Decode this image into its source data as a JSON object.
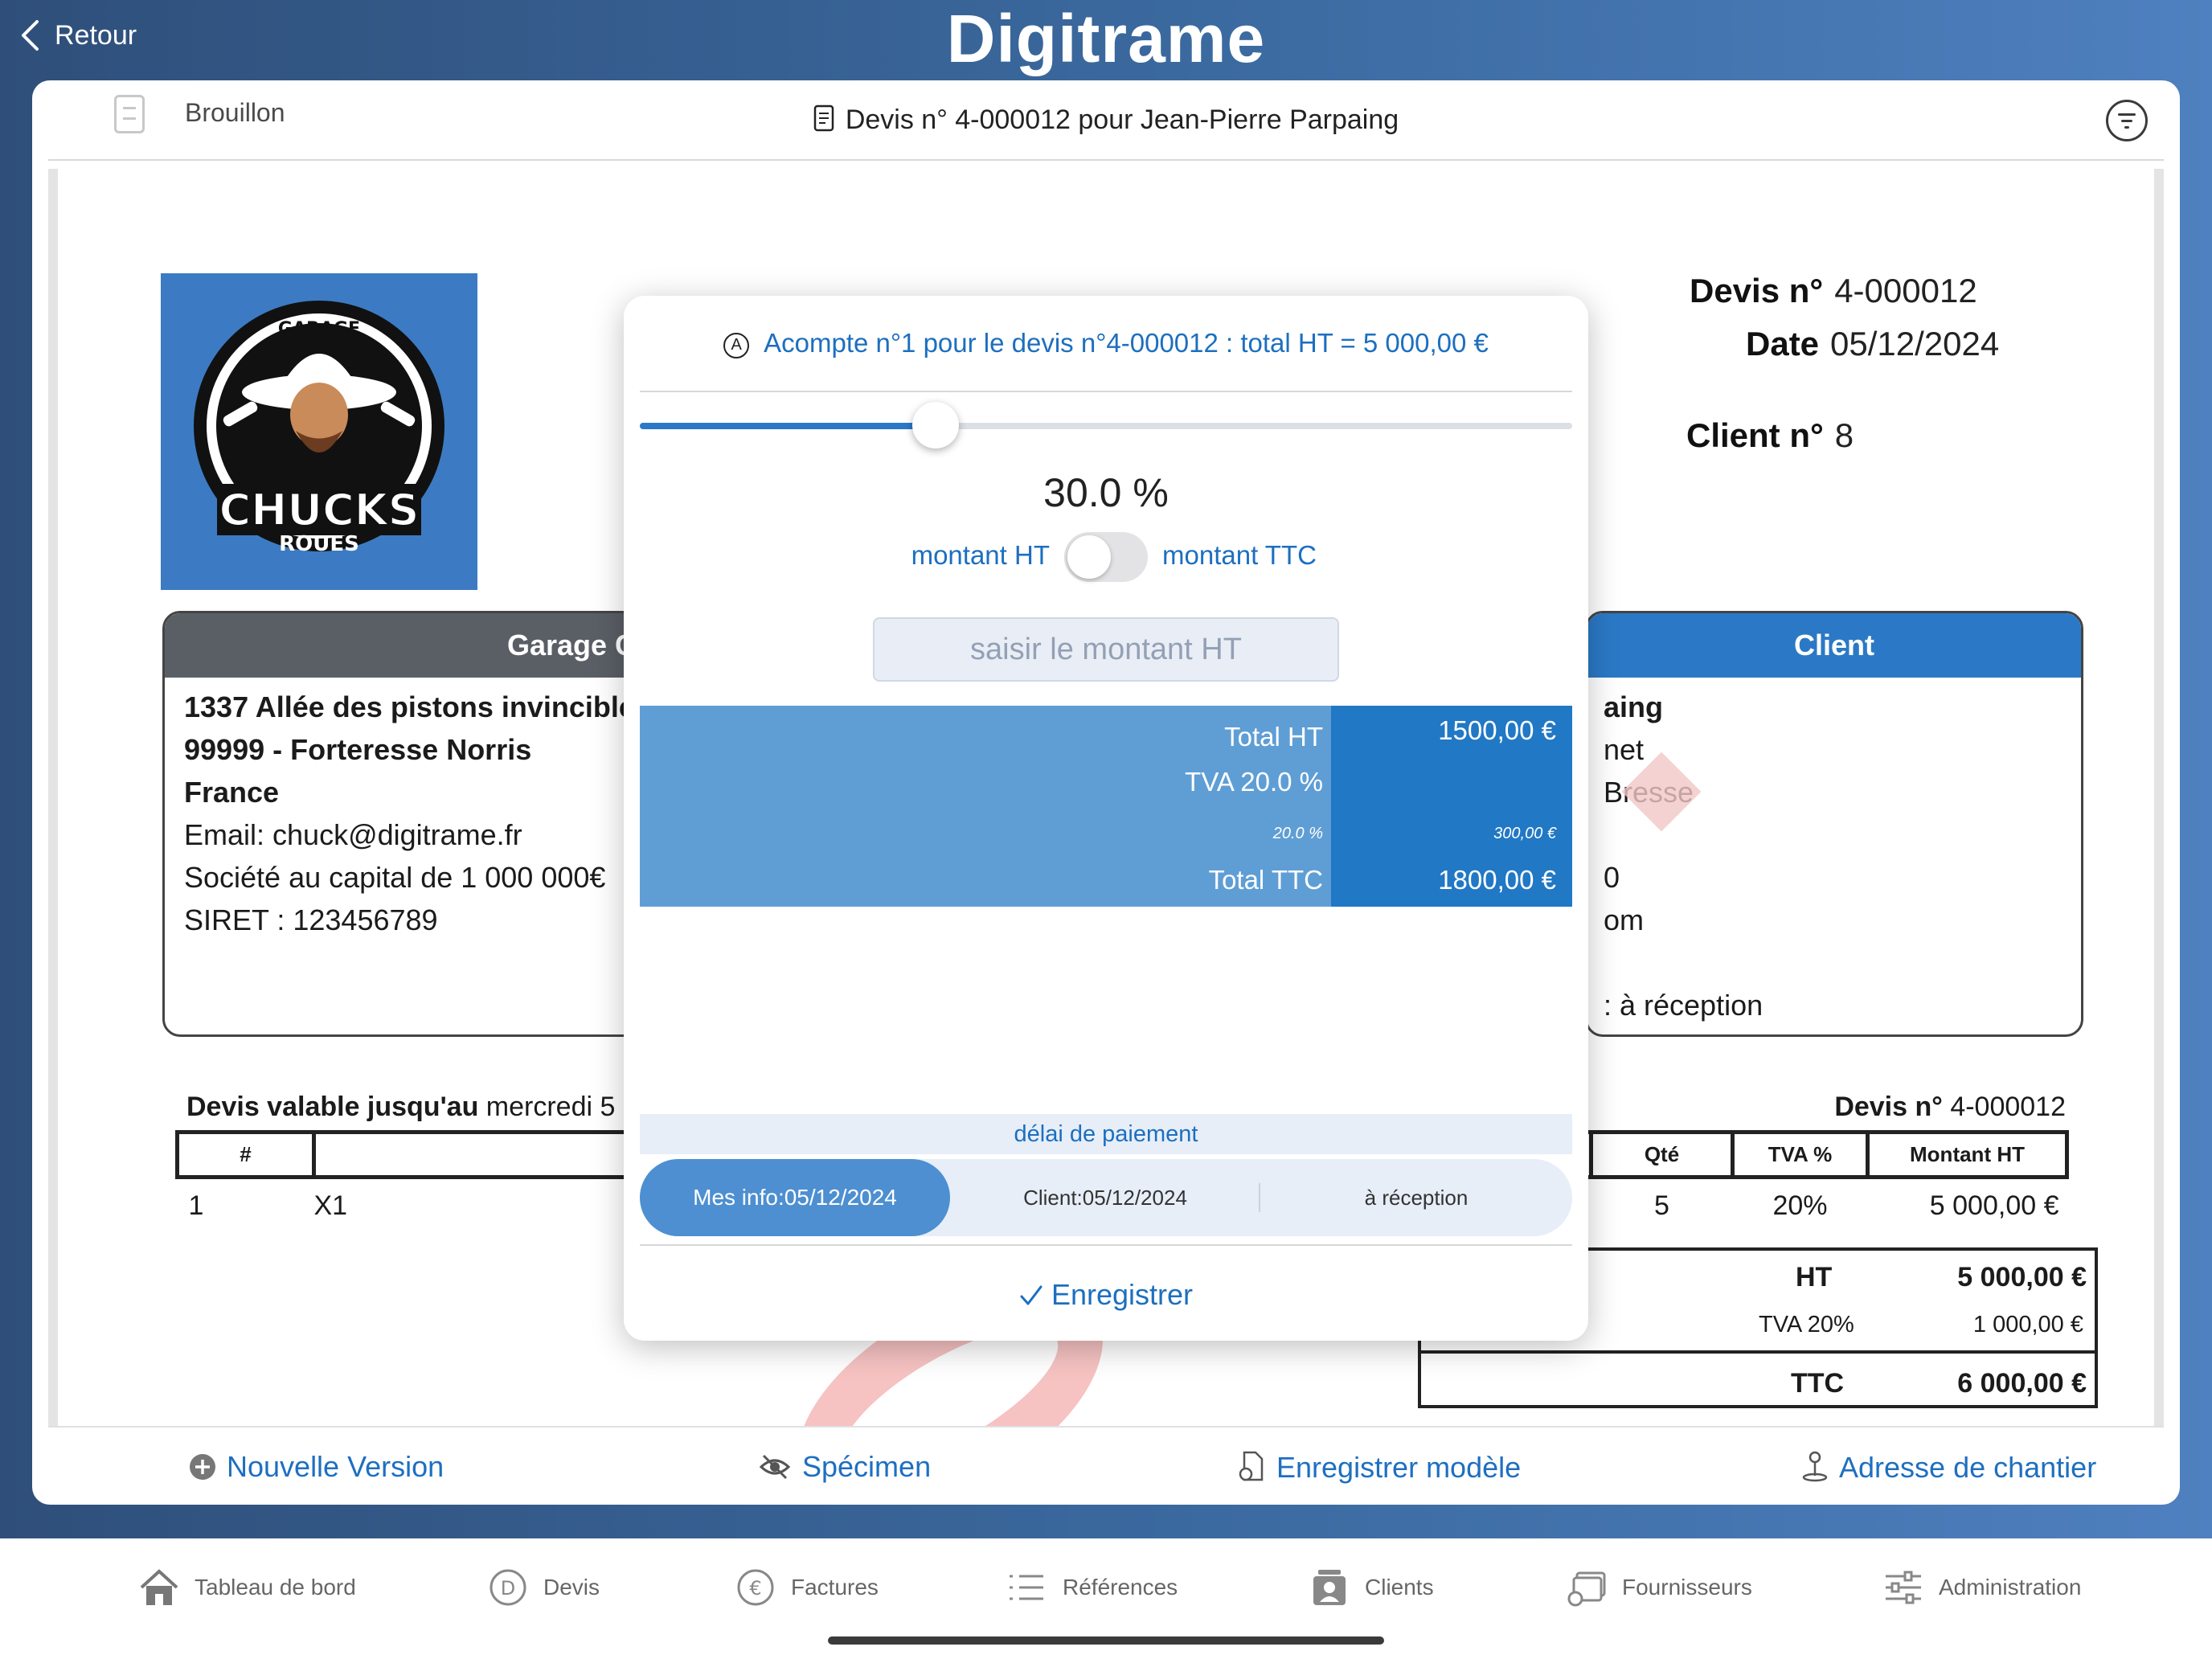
{
  "topbar": {
    "back_label": "Retour",
    "brand": "Digitrame"
  },
  "header": {
    "status_label": "Brouillon",
    "title": "Devis n° 4-000012 pour Jean-Pierre Parpaing"
  },
  "document": {
    "logo_text_main": "CHUCKS",
    "logo_text_top": "GARAGE",
    "logo_text_bottom": "ROUES",
    "meta": {
      "devis_label": "Devis n°",
      "devis_value": "4-000012",
      "date_label": "Date",
      "date_value": "05/12/2024",
      "client_label": "Client n°",
      "client_value": "8"
    },
    "company_box": {
      "title": "Garage Chuck Ro",
      "lines": [
        "1337 Allée des pistons invincibles",
        "99999 - Forteresse Norris",
        "France",
        "Email: chuck@digitrame.fr",
        "Société au capital de 1 000 000€",
        "SIRET : 123456789"
      ]
    },
    "client_box": {
      "title": "Client",
      "lines": [
        "aing",
        "net",
        "Bresse",
        "",
        "0",
        "om",
        "",
        ": à réception"
      ]
    },
    "validity_label": "Devis valable jusqu'au",
    "validity_value": "mercredi 5",
    "devis_no_label": "Devis n°",
    "devis_no_value": "4-000012",
    "table_headers": [
      "#",
      "",
      "Qté",
      "TVA %",
      "Montant HT"
    ],
    "table_rows": [
      [
        "1",
        "X1",
        "5",
        "20%",
        "5 000,00 €"
      ]
    ],
    "totals": {
      "ht_label": "HT",
      "ht_value": "5 000,00 €",
      "tva_label": "TVA 20%",
      "tva_value": "1 000,00 €",
      "ttc_label": "TTC",
      "ttc_value": "6 000,00 €"
    }
  },
  "actions": {
    "new_version": "Nouvelle Version",
    "specimen": "Spécimen",
    "save_template": "Enregistrer modèle",
    "site_address": "Adresse de chantier"
  },
  "modal": {
    "title_badge": "A",
    "title": "Acompte n°1 pour le devis n°4-000012 : total HT = 5 000,00 €",
    "slider_fraction": 0.3,
    "percent_text": "30.0 %",
    "toggle_left": "montant HT",
    "toggle_right": "montant TTC",
    "toggle_on": false,
    "amount_placeholder": "saisir le montant HT",
    "summary": {
      "total_ht_label": "Total HT",
      "total_ht_value": "1500,00 €",
      "tva_label": "TVA 20.0 %",
      "tva_rate_small": "20.0 %",
      "tva_amount_small": "300,00 €",
      "total_ttc_label": "Total TTC",
      "total_ttc_value": "1800,00 €"
    },
    "delay_label": "délai de paiement",
    "segments": [
      "Mes info:05/12/2024",
      "Client:05/12/2024",
      "à réception"
    ],
    "active_segment": 0,
    "save_label": "Enregistrer"
  },
  "tabbar": {
    "items": [
      {
        "label": "Tableau de bord",
        "icon": "home-icon"
      },
      {
        "label": "Devis",
        "icon": "devis-icon"
      },
      {
        "label": "Factures",
        "icon": "euro-icon"
      },
      {
        "label": "Références",
        "icon": "list-icon"
      },
      {
        "label": "Clients",
        "icon": "clients-icon"
      },
      {
        "label": "Fournisseurs",
        "icon": "suppliers-icon"
      },
      {
        "label": "Administration",
        "icon": "sliders-icon"
      }
    ]
  },
  "colors": {
    "accent": "#1c6fbf",
    "summary_light": "#5f9ed5",
    "summary_dark": "#2178c5",
    "logo_bg": "#3c7bc3"
  }
}
